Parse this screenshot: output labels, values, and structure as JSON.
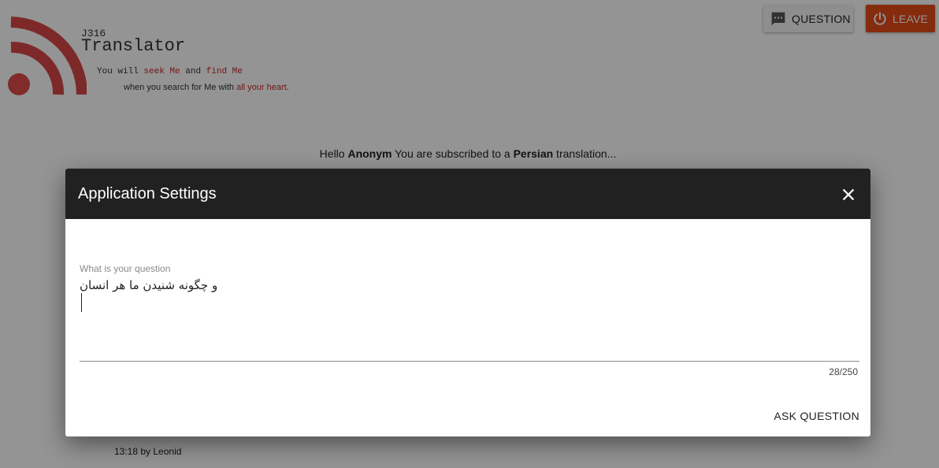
{
  "brand": {
    "code": "J316",
    "title": "Translator",
    "tagline_1": [
      "You will ",
      "seek Me",
      " and ",
      "find Me"
    ],
    "tagline_2": [
      "when you search for Me with ",
      "all your heart",
      "."
    ],
    "highlight_color": "#c62828"
  },
  "header": {
    "question_label": "QUESTION",
    "question_icon": "chat-bubble-icon",
    "leave_label": "LEAVE",
    "leave_icon": "power-icon",
    "leave_color": "#e64a19"
  },
  "greeting": {
    "hello": "Hello ",
    "user": "Anonym",
    "middle": " You are subscribed to a ",
    "language": "Persian",
    "end": " translation..."
  },
  "footer": {
    "time_text": "13:18 by Leonid"
  },
  "dialog": {
    "title": "Application Settings",
    "close_icon": "close-icon",
    "field_label": "What is your question",
    "field_value": "و چگونه شنیدن ما هر انسان\n",
    "counter": "28/250",
    "ask_label": "ASK QUESTION",
    "header_color": "#212121"
  }
}
